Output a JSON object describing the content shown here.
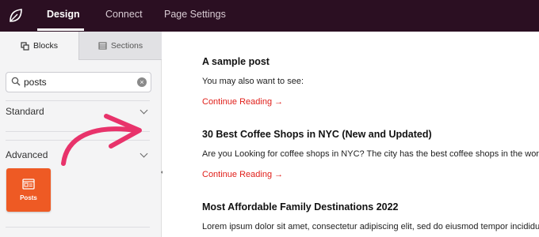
{
  "topbar": {
    "logo_icon": "leaf-icon",
    "tabs": [
      {
        "label": "Design",
        "active": true
      },
      {
        "label": "Connect",
        "active": false
      },
      {
        "label": "Page Settings",
        "active": false
      }
    ]
  },
  "sidebar": {
    "tabs": [
      {
        "label": "Blocks",
        "icon": "blocks-icon",
        "active": true
      },
      {
        "label": "Sections",
        "icon": "sections-icon",
        "active": false
      }
    ],
    "search": {
      "value": "posts",
      "placeholder": ""
    },
    "groups": [
      {
        "label": "Standard",
        "expanded": false
      },
      {
        "label": "Advanced",
        "expanded": true
      }
    ],
    "blocks": [
      {
        "label": "Posts",
        "icon": "posts-icon"
      }
    ],
    "accent_color": "#ee5a24",
    "annotation_arrow_color": "#e8336b"
  },
  "main": {
    "posts": [
      {
        "title": "A sample post",
        "excerpt": "You may also want to see:",
        "link": "Continue Reading →"
      },
      {
        "title": "30 Best Coffee Shops in NYC (New and Updated)",
        "excerpt": "Are you Looking for coffee shops in NYC? The city has the best coffee shops in the world. I",
        "link": "Continue Reading →"
      },
      {
        "title": "Most Affordable Family Destinations 2022",
        "excerpt": "Lorem ipsum dolor sit amet, consectetur adipiscing elit, sed do eiusmod tempor incididunt",
        "link": ""
      }
    ],
    "link_color": "#e0201b"
  }
}
